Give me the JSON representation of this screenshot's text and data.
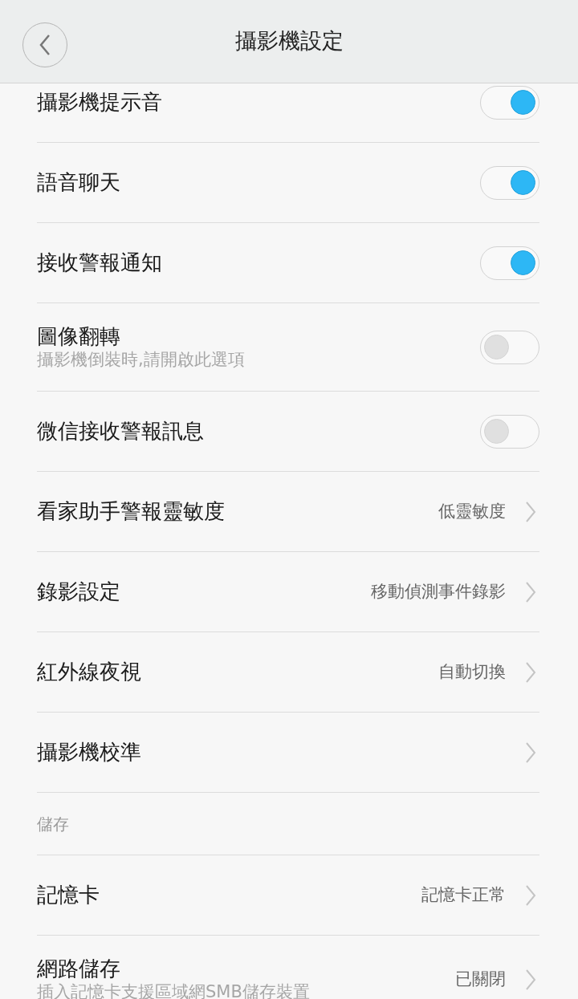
{
  "header": {
    "title": "攝影機設定"
  },
  "items": [
    {
      "kind": "toggle",
      "label": "攝影機提示音",
      "on": true
    },
    {
      "kind": "toggle",
      "label": "語音聊天",
      "on": true
    },
    {
      "kind": "toggle",
      "label": "接收警報通知",
      "on": true
    },
    {
      "kind": "toggle",
      "label": "圖像翻轉",
      "subtitle": "攝影機倒裝時,請開啟此選項",
      "on": false
    },
    {
      "kind": "toggle",
      "label": "微信接收警報訊息",
      "on": false
    },
    {
      "kind": "link",
      "label": "看家助手警報靈敏度",
      "value": "低靈敏度"
    },
    {
      "kind": "link",
      "label": "錄影設定",
      "value": "移動偵測事件錄影"
    },
    {
      "kind": "link",
      "label": "紅外線夜視",
      "value": "自動切換"
    },
    {
      "kind": "link",
      "label": "攝影機校準"
    },
    {
      "kind": "section",
      "label": "儲存"
    },
    {
      "kind": "link",
      "label": "記憶卡",
      "value": "記憶卡正常"
    },
    {
      "kind": "link",
      "label": "網路儲存",
      "subtitle": "插入記憶卡支援區域網SMB儲存裝置",
      "value": "已關閉"
    }
  ]
}
